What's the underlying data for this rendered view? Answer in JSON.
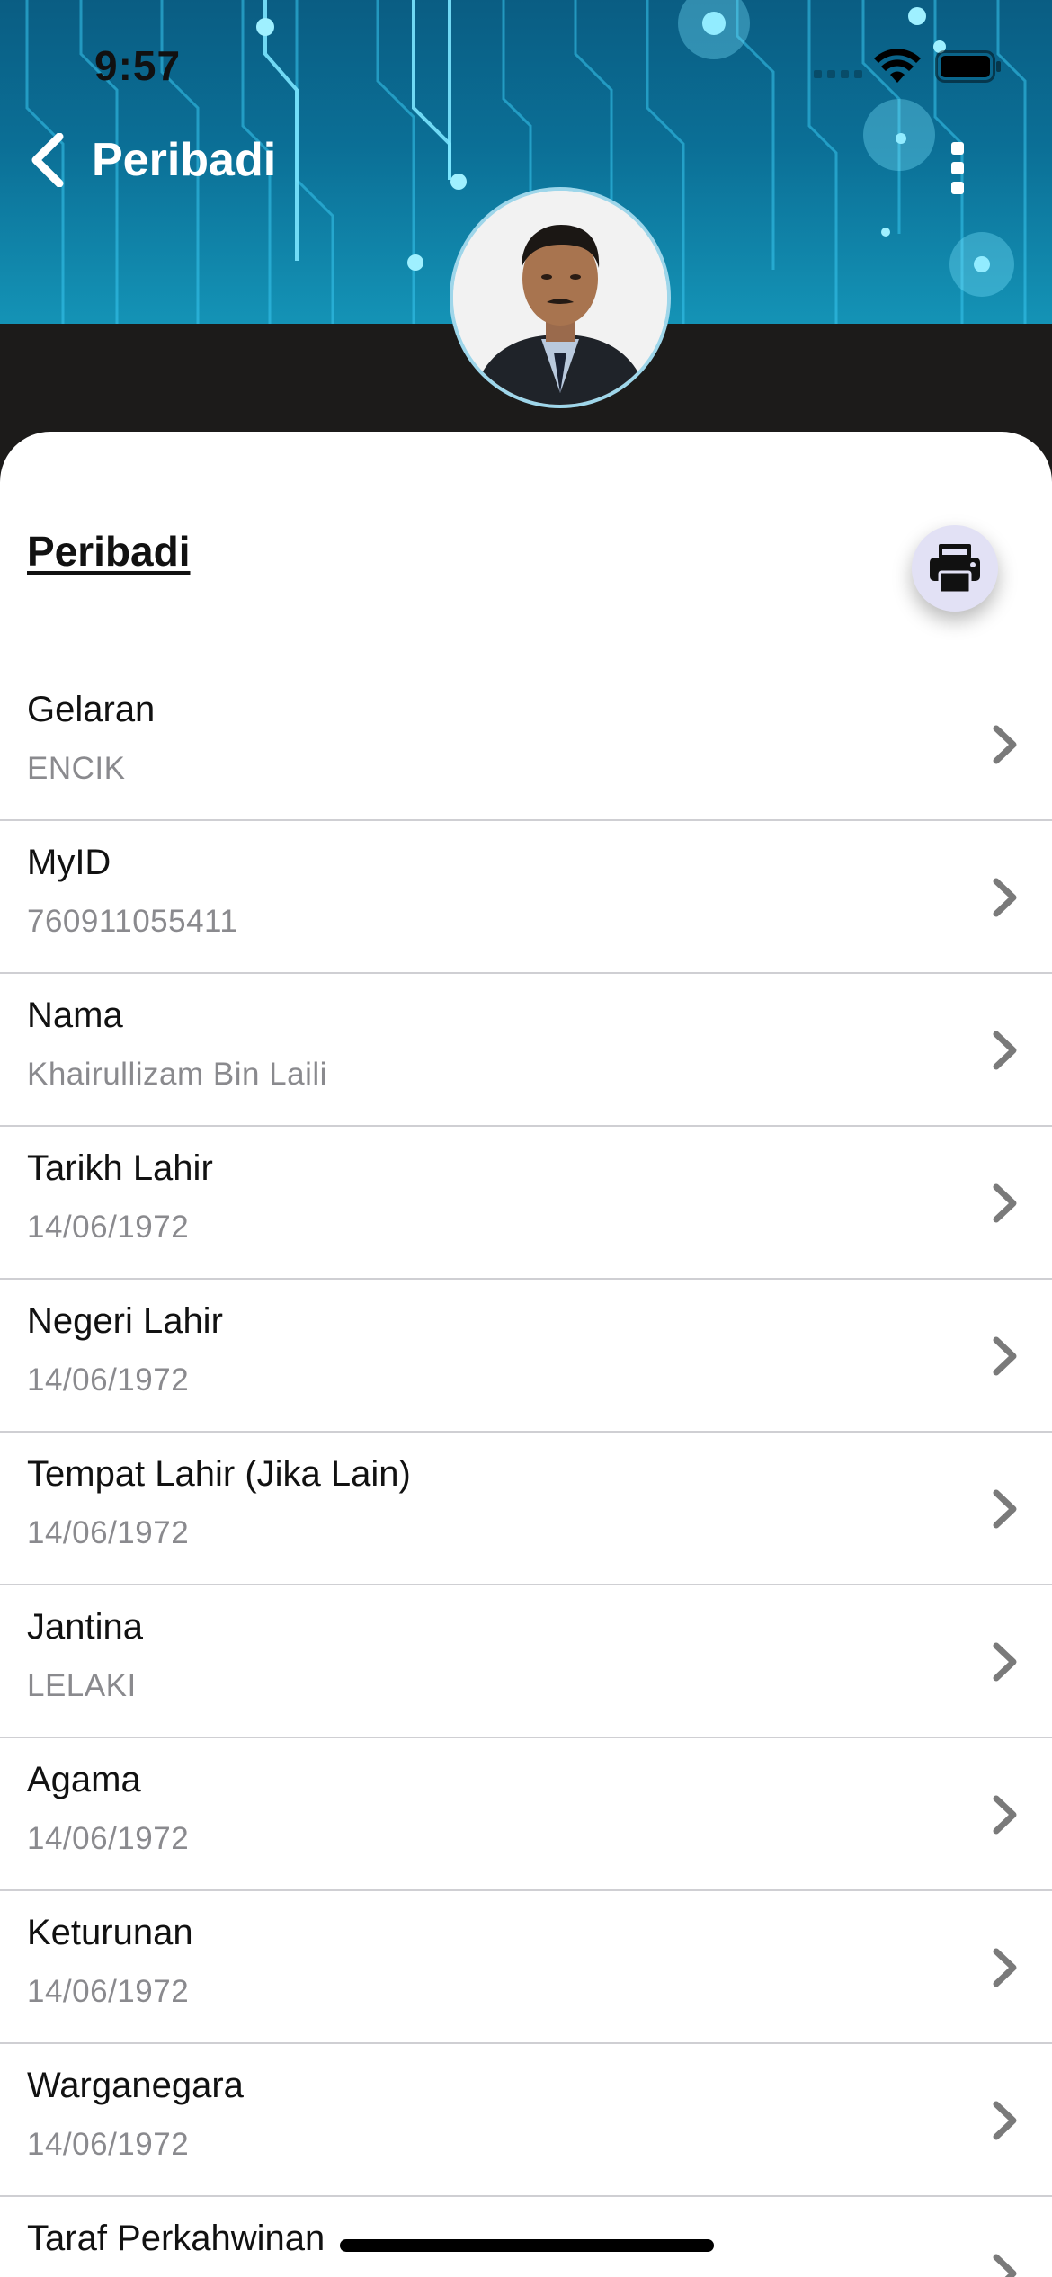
{
  "status_bar": {
    "time": "9:57",
    "wifi_icon": "wifi-icon",
    "battery_icon": "battery-full-icon"
  },
  "nav": {
    "back_icon": "chevron-left-icon",
    "title": "Peribadi",
    "more_icon": "more-vertical-icon"
  },
  "profile": {
    "avatar": "profile-photo"
  },
  "section": {
    "title": "Peribadi",
    "print_icon": "printer-icon"
  },
  "fields": [
    {
      "label": "Gelaran",
      "value": "ENCIK"
    },
    {
      "label": "MyID",
      "value": "760911055411"
    },
    {
      "label": "Nama",
      "value": "Khairullizam Bin Laili"
    },
    {
      "label": "Tarikh Lahir",
      "value": "14/06/1972"
    },
    {
      "label": "Negeri Lahir",
      "value": "14/06/1972"
    },
    {
      "label": "Tempat Lahir (Jika Lain)",
      "value": "14/06/1972"
    },
    {
      "label": "Jantina",
      "value": "LELAKI"
    },
    {
      "label": "Agama",
      "value": "14/06/1972"
    },
    {
      "label": "Keturunan",
      "value": "14/06/1972"
    },
    {
      "label": "Warganegara",
      "value": "14/06/1972"
    },
    {
      "label": "Taraf Perkahwinan",
      "value": ""
    }
  ],
  "colors": {
    "header_bg": "#0b6f96",
    "band_bg": "#1c1b1a",
    "card_bg": "#ffffff",
    "label_text": "#111111",
    "value_text": "#8a8a8e",
    "chevron": "#7a7a7a",
    "print_button_bg": "#e2e1f5"
  }
}
